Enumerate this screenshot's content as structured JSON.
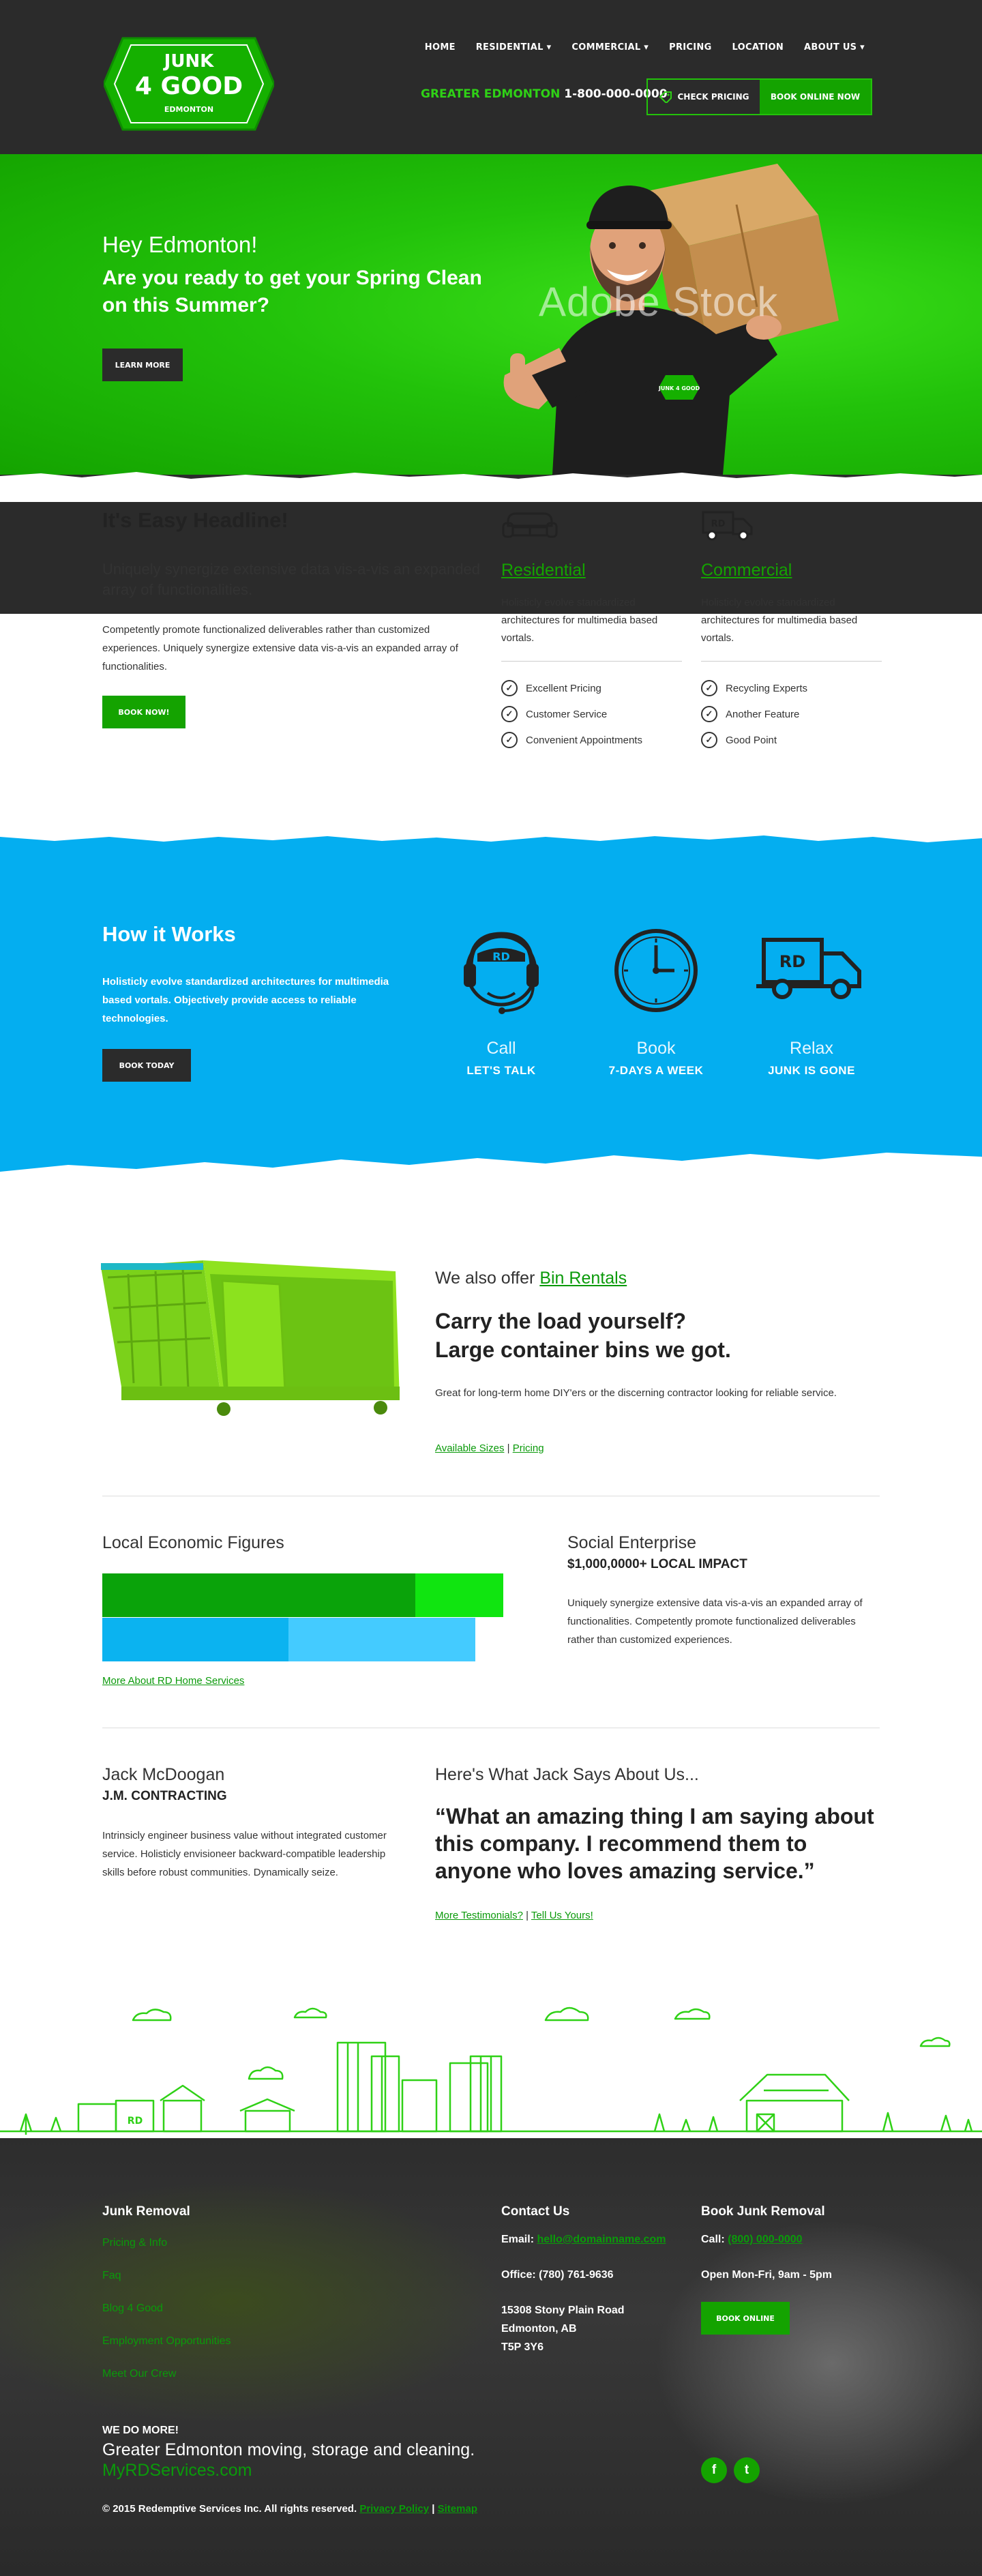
{
  "header": {
    "logo": {
      "line1": "JUNK",
      "line2": "4 GOOD",
      "line3": "EDMONTON"
    },
    "nav": [
      "HOME",
      "RESIDENTIAL ▾",
      "COMMERCIAL ▾",
      "PRICING",
      "LOCATION",
      "ABOUT US ▾"
    ],
    "region": "GREATER EDMONTON",
    "phone": "1-800-000-0000",
    "check_pricing": "CHECK PRICING",
    "book_online": "BOOK ONLINE NOW"
  },
  "hero": {
    "greeting": "Hey Edmonton!",
    "headline": "Are you ready to get your Spring Clean on this Summer?",
    "cta": "LEARN MORE",
    "watermark": "Adobe Stock",
    "shirt_logo": "JUNK 4 GOOD"
  },
  "easy": {
    "headline": "It's Easy Headline!",
    "subhead": "Uniquely synergize extensive data vis-a-vis an expanded array of functionalities.",
    "body": "Competently promote functionalized deliverables rather than customized experiences. Uniquely synergize extensive data vis-a-vis an expanded array of functionalities.",
    "cta": "BOOK NOW!",
    "services": [
      {
        "icon": "couch-icon",
        "title": "Residential",
        "desc": "Holisticly evolve standardized architectures for multimedia based vortals.",
        "features": [
          "Excellent Pricing",
          "Customer Service",
          "Convenient Appointments"
        ]
      },
      {
        "icon": "truck-icon",
        "title": "Commercial",
        "desc": "Holisticly evolve standardized architectures for multimedia based vortals.",
        "features": [
          "Recycling Experts",
          "Another Feature",
          "Good Point"
        ]
      }
    ]
  },
  "how": {
    "headline": "How it Works",
    "body": "Holisticly evolve standardized architectures for multimedia based vortals. Objectively provide access to reliable technologies.",
    "cta": "BOOK TODAY",
    "steps": [
      {
        "icon": "headset-agent-icon",
        "title": "Call",
        "sub": "LET'S TALK"
      },
      {
        "icon": "clock-icon",
        "title": "Book",
        "sub": "7-DAYS A WEEK"
      },
      {
        "icon": "truck-icon",
        "title": "Relax",
        "sub": "JUNK IS GONE"
      }
    ],
    "badge": "RD"
  },
  "bins": {
    "offer_prefix": "We also offer ",
    "offer_link": "Bin Rentals",
    "headline_1": "Carry the load yourself?",
    "headline_2": "Large container bins we got.",
    "body": "Great for long-term home DIY'ers or the discerning contractor looking for reliable service.",
    "link_sizes": "Available Sizes",
    "sep": " | ",
    "link_pricing": "Pricing"
  },
  "figures": {
    "headline": "Local Economic Figures",
    "bars": [
      {
        "primary": 0.78,
        "secondary": 0.22,
        "primary_color": "#0aa30a",
        "secondary_color": "#10e510",
        "width": 1.0
      },
      {
        "primary": 0.5,
        "secondary": 0.5,
        "primary_color": "#0bb3f0",
        "secondary_color": "#44cbff",
        "width": 0.93
      }
    ],
    "link": "More About RD Home Services"
  },
  "social": {
    "headline": "Social Enterprise",
    "sub": "$1,000,0000+ LOCAL IMPACT",
    "body": "Uniquely synergize extensive data vis-a-vis an expanded array of functionalities. Competently promote functionalized deliverables rather than customized experiences."
  },
  "testimonial": {
    "name": "Jack McDoogan",
    "company": "J.M. CONTRACTING",
    "bio": "Intrinsicly engineer business value without integrated customer service. Holisticly envisioneer backward-compatible leadership skills before robust communities. Dynamically seize.",
    "says": "Here's What Jack Says About Us...",
    "quote": "“What an amazing thing I am saying about this company. I recommend them to anyone who loves amazing service.”",
    "link_more": "More Testimonials?",
    "sep": " | ",
    "link_tell": "Tell Us Yours!"
  },
  "footer": {
    "col1_h": "Junk Removal",
    "links": [
      "Pricing & Info",
      "Faq",
      "Blog 4 Good",
      "Employment Opportunities",
      "Meet Our Crew"
    ],
    "col2_h": "Contact Us",
    "email_label": "Email: ",
    "email": "hello@domainname.com",
    "office": "Office: (780) 761-9636",
    "addr1": "15308 Stony Plain Road",
    "addr2": "Edmonton, AB",
    "addr3": "T5P 3Y6",
    "col3_h": "Book Junk Removal",
    "call_label": "Call: ",
    "call": "(800) 000-0000",
    "hours": "Open Mon-Fri, 9am - 5pm",
    "book": "BOOK ONLINE",
    "more_h": "WE DO MORE!",
    "more_t": "Greater Edmonton moving, storage and cleaning.",
    "more_u": "MyRDServices.com",
    "copyright": "© 2015 Redemptive Services Inc. All rights reserved. ",
    "privacy": "Privacy Policy",
    "sep": " | ",
    "sitemap": "Sitemap",
    "social": [
      "f",
      "t"
    ]
  }
}
